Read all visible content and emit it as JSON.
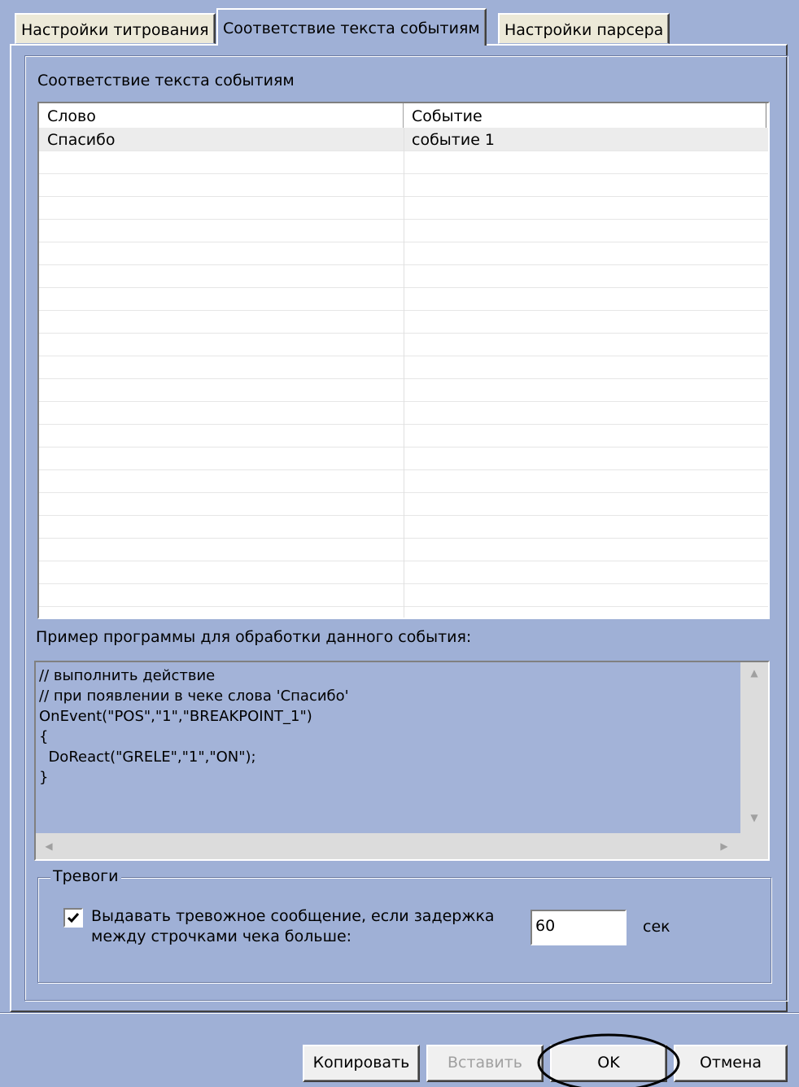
{
  "tabs": [
    {
      "label": "Настройки титрования",
      "active": false
    },
    {
      "label": "Соответствие текста событиям",
      "active": true
    },
    {
      "label": "Настройки парсера",
      "active": false
    }
  ],
  "mapping_group": {
    "title": "Соответствие текста событиям",
    "columns": [
      "Слово",
      "Событие"
    ],
    "rows": [
      {
        "word": "Спасибо",
        "event": "событие 1"
      }
    ]
  },
  "example": {
    "label": "Пример программы для обработки данного события:",
    "code_lines": [
      "// выполнить действие",
      "// при появлении в чеке слова 'Спасибо'",
      "OnEvent(\"POS\",\"1\",\"BREAKPOINT_1\")",
      "{",
      "  DoReact(\"GRELE\",\"1\",\"ON\");",
      "}"
    ],
    "scroll_up_glyph": "▲",
    "scroll_down_glyph": "▼",
    "scroll_left_glyph": "◀",
    "scroll_right_glyph": "▶"
  },
  "alarms": {
    "title": "Тревоги",
    "checkbox_checked": true,
    "checkbox_label_line1": "Выдавать тревожное сообщение, если задержка",
    "checkbox_label_line2": "между строчками чека больше:",
    "delay_value": "60",
    "unit": "сек"
  },
  "buttons": {
    "copy": "Копировать",
    "paste": "Вставить",
    "ok": "OK",
    "cancel": "Отмена"
  },
  "colors": {
    "dialog_bg": "#9fb0d6",
    "highlight_ellipse": "#000000"
  }
}
